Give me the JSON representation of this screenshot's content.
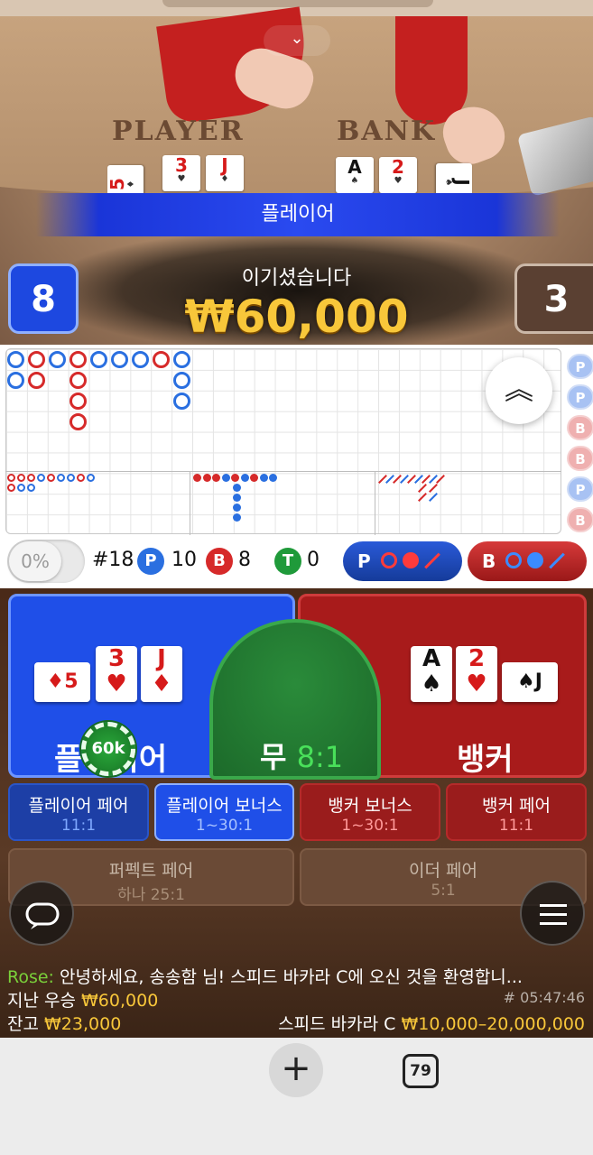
{
  "video": {
    "player_label": "PLAYER",
    "banker_label": "BANK",
    "player_cards": [
      {
        "rank": "5",
        "suit": "♦",
        "color": "red"
      },
      {
        "rank": "3",
        "suit": "♥",
        "color": "red"
      },
      {
        "rank": "J",
        "suit": "♦",
        "color": "red"
      }
    ],
    "banker_cards": [
      {
        "rank": "A",
        "suit": "♠",
        "color": "black"
      },
      {
        "rank": "2",
        "suit": "♥",
        "color": "red"
      },
      {
        "rank": "J",
        "suit": "♠",
        "color": "black"
      }
    ],
    "result_banner": "플레이어",
    "win_text": "이기셨습니다",
    "win_amount": "₩60,000",
    "player_score": "8",
    "banker_score": "3",
    "collapse_icon": "chevron-double-down-icon"
  },
  "roads": {
    "predict": [
      "P",
      "P",
      "B",
      "B",
      "P",
      "B"
    ],
    "expand_icon": "chevron-double-up-icon"
  },
  "stats": {
    "percent": "0%",
    "round": "#18",
    "player_letter": "P",
    "player_count": "10",
    "banker_letter": "B",
    "banker_count": "8",
    "tie_letter": "T",
    "tie_count": "0",
    "ask_player": "P",
    "ask_banker": "B"
  },
  "betting": {
    "player_label": "플레이어",
    "banker_label": "뱅커",
    "tie_label": "무",
    "tie_odds": "8:1",
    "chip_value": "60k",
    "player_cards": [
      {
        "rank": "5",
        "suit": "♦",
        "color": "red"
      },
      {
        "rank": "3",
        "suit": "♥",
        "color": "red"
      },
      {
        "rank": "J",
        "suit": "♦",
        "color": "red"
      }
    ],
    "banker_cards": [
      {
        "rank": "A",
        "suit": "♠",
        "color": "black"
      },
      {
        "rank": "2",
        "suit": "♥",
        "color": "red"
      },
      {
        "rank": "J",
        "suit": "♠",
        "color": "black"
      }
    ],
    "side_bets": [
      {
        "name": "플레이어 페어",
        "odds": "11:1"
      },
      {
        "name": "플레이어 보너스",
        "odds": "1~30:1"
      },
      {
        "name": "뱅커 보너스",
        "odds": "1~30:1"
      },
      {
        "name": "뱅커 페어",
        "odds": "11:1"
      },
      {
        "name": "퍼펙트 페어",
        "odds": "하나 25:1"
      },
      {
        "name": "이더 페어",
        "odds": "5:1"
      }
    ],
    "chat_icon": "chat-bubble-icon",
    "menu_icon": "hamburger-menu-icon"
  },
  "info": {
    "chat_sender": "Rose:",
    "chat_message": "안녕하세요, 송송함 님! 스피드 바카라 C에 오신 것을 환영합니...",
    "last_win_label": "지난 우승",
    "last_win_value": "₩60,000",
    "round_id": "# 05:47:46",
    "balance_label": "잔고",
    "balance_value": "₩23,000",
    "table_name": "스피드 바카라 C",
    "table_limits": "₩10,000–20,000,000"
  },
  "browser": {
    "back_icon": "arrow-left-icon",
    "forward_icon": "arrow-right-icon",
    "new_tab_icon": "plus-icon",
    "tab_count": "79",
    "more_icon": "more-horizontal-icon"
  },
  "colors": {
    "player_blue": "#1f4fe8",
    "banker_red": "#a81b1b",
    "tie_green": "#2a8b3a",
    "gold": "#f8c73a"
  }
}
